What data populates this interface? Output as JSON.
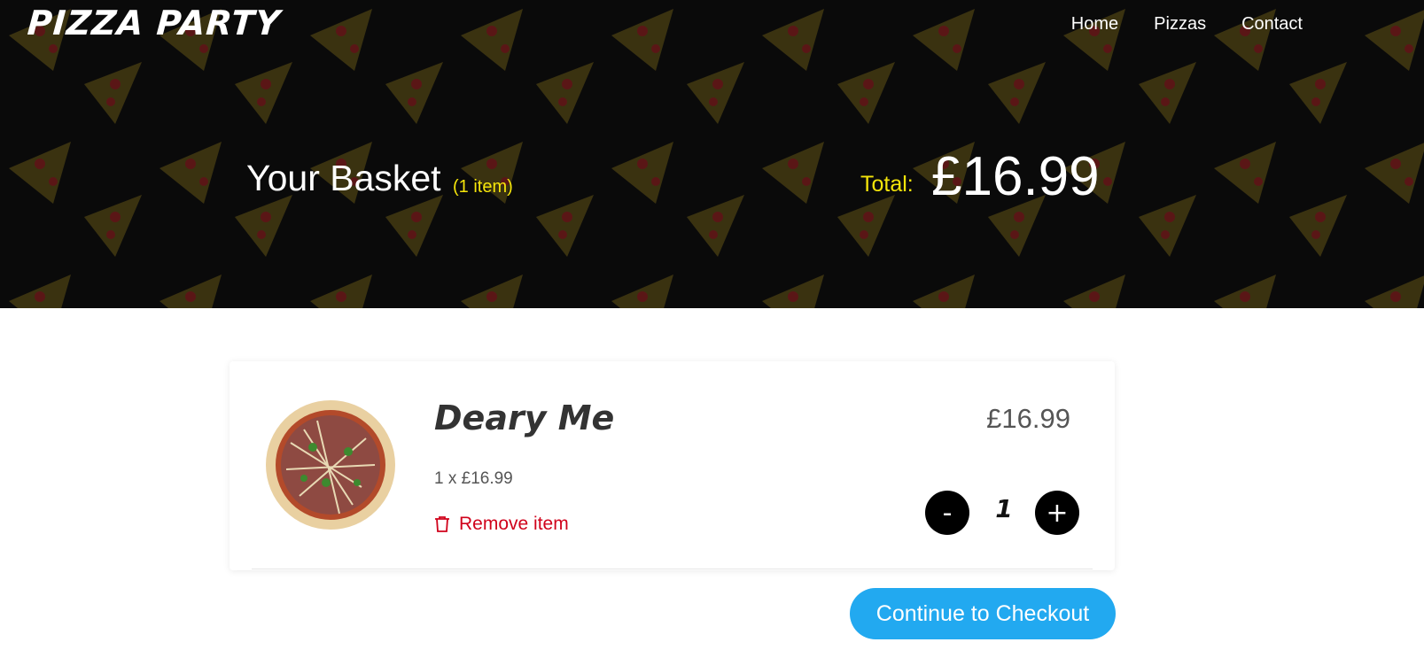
{
  "brand": {
    "logo_text": "PIZZA PARTY"
  },
  "nav": {
    "items": [
      "Home",
      "Pizzas",
      "Contact"
    ]
  },
  "basket": {
    "title": "Your Basket",
    "count_label": "(1 item)",
    "total_label": "Total:",
    "total_value": "£16.99"
  },
  "items": [
    {
      "name": "Deary Me",
      "qty_price": "1 x £16.99",
      "line_price": "£16.99",
      "quantity": "1",
      "remove_label": "Remove item",
      "minus_label": "-",
      "plus_label": "+"
    }
  ],
  "checkout": {
    "label": "Continue to Checkout"
  },
  "colors": {
    "hero_bg": "#0a0a0a",
    "accent_yellow": "#f5e50a",
    "remove_red": "#d0021b",
    "checkout_blue": "#22a9f0"
  },
  "icons": [
    "pizza-slice-pattern",
    "trash-icon",
    "pizza-image"
  ]
}
